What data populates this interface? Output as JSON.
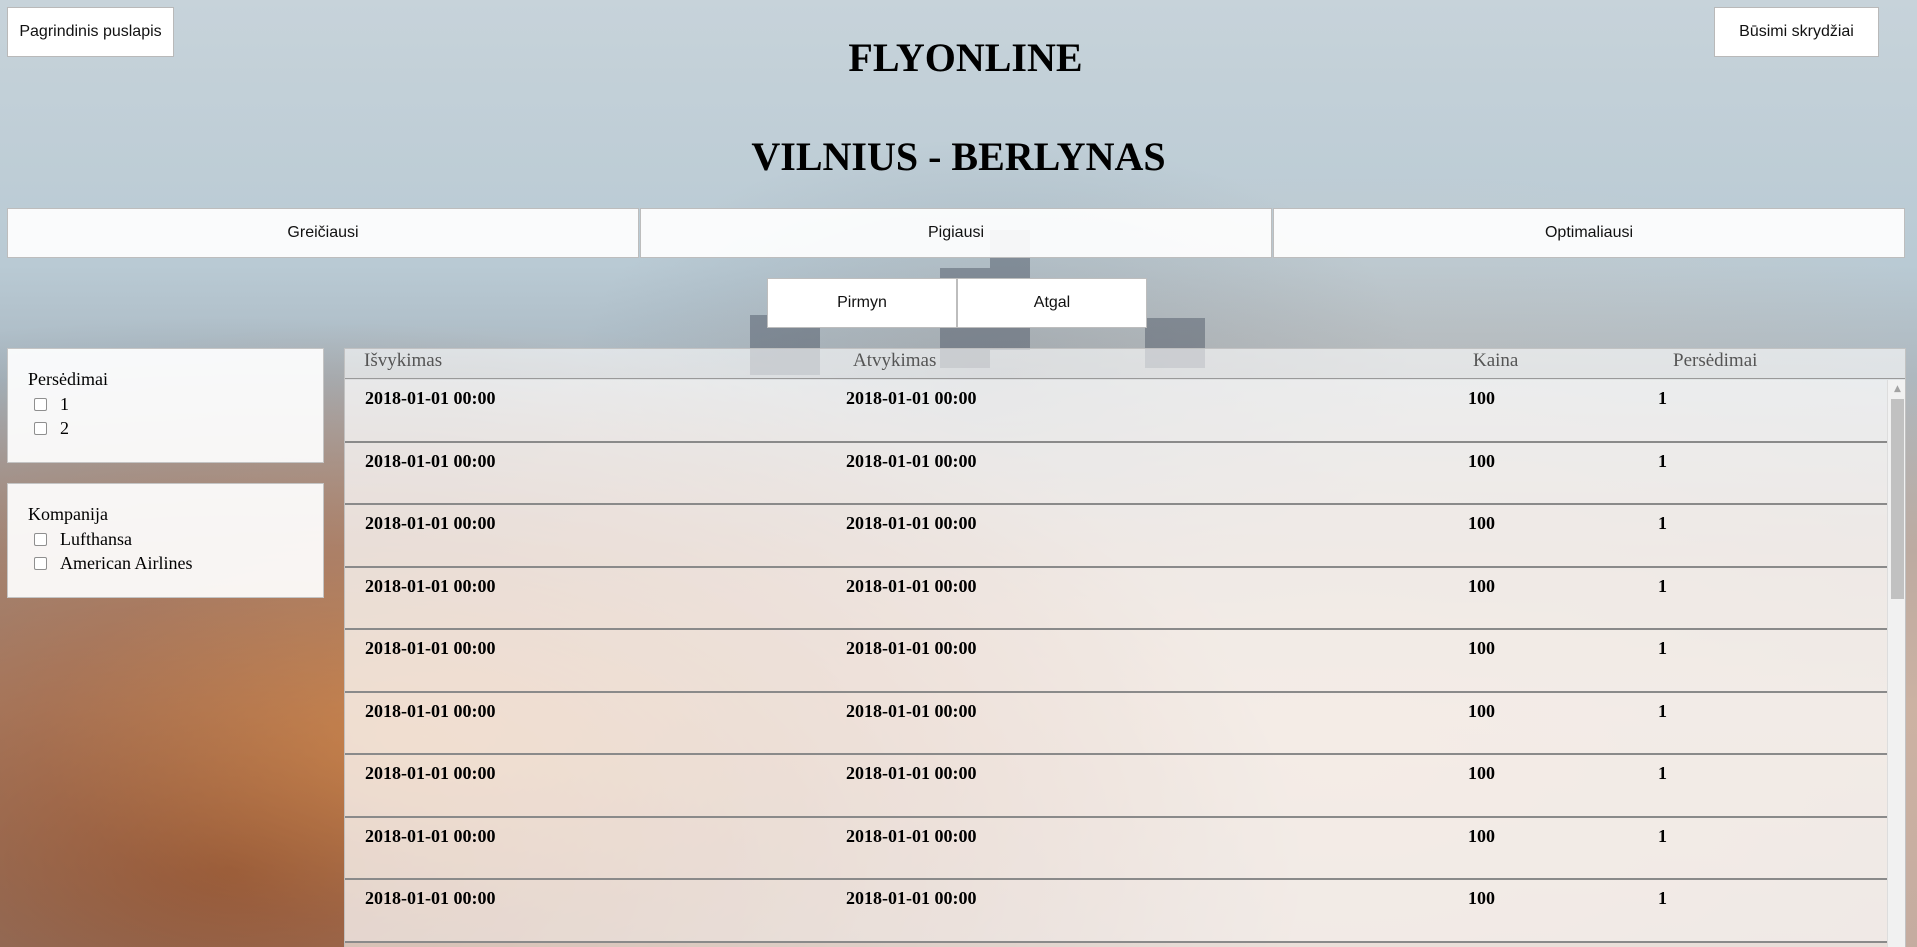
{
  "header": {
    "home_label": "Pagrindinis puslapis",
    "upcoming_label": "Būsimi skrydžiai",
    "site_title": "FLYONLINE",
    "route_title": "VILNIUS - BERLYNAS"
  },
  "sort": {
    "fastest": "Greičiausi",
    "cheapest": "Pigiausi",
    "optimal": "Optimaliausi"
  },
  "nav": {
    "forward": "Pirmyn",
    "back": "Atgal"
  },
  "filters": {
    "transfers": {
      "title": "Persėdimai",
      "options": [
        "1",
        "2"
      ]
    },
    "company": {
      "title": "Kompanija",
      "options": [
        "Lufthansa",
        "American Airlines"
      ]
    }
  },
  "table": {
    "columns": [
      "Išvykimas",
      "Atvykimas",
      "Kaina",
      "Persėdimai"
    ],
    "rows": [
      [
        "2018-01-01 00:00",
        "2018-01-01 00:00",
        "100",
        "1"
      ],
      [
        "2018-01-01 00:00",
        "2018-01-01 00:00",
        "100",
        "1"
      ],
      [
        "2018-01-01 00:00",
        "2018-01-01 00:00",
        "100",
        "1"
      ],
      [
        "2018-01-01 00:00",
        "2018-01-01 00:00",
        "100",
        "1"
      ],
      [
        "2018-01-01 00:00",
        "2018-01-01 00:00",
        "100",
        "1"
      ],
      [
        "2018-01-01 00:00",
        "2018-01-01 00:00",
        "100",
        "1"
      ],
      [
        "2018-01-01 00:00",
        "2018-01-01 00:00",
        "100",
        "1"
      ],
      [
        "2018-01-01 00:00",
        "2018-01-01 00:00",
        "100",
        "1"
      ],
      [
        "2018-01-01 00:00",
        "2018-01-01 00:00",
        "100",
        "1"
      ]
    ]
  },
  "icons": {
    "scroll_up": "scroll-up-arrow-icon"
  }
}
